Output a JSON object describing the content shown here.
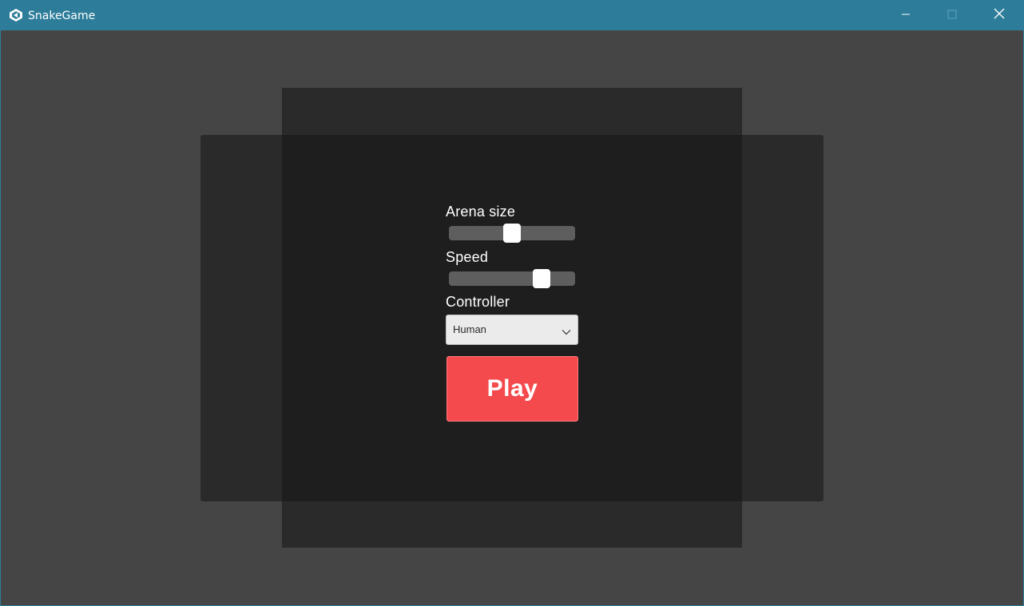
{
  "window": {
    "title": "SnakeGame",
    "titlebar_color": "#2d7d9a",
    "background_color": "#454545",
    "icons": {
      "app": "unity-logo-icon",
      "minimize": "minimize-icon",
      "maximize": "maximize-icon",
      "close": "close-icon"
    }
  },
  "menu": {
    "arena_size": {
      "label": "Arena size",
      "value_fraction": 0.5
    },
    "speed": {
      "label": "Speed",
      "value_fraction": 0.77
    },
    "controller": {
      "label": "Controller",
      "selected": "Human",
      "icon": "chevron-down-icon"
    },
    "play": {
      "label": "Play",
      "color": "#f44a4e"
    }
  }
}
